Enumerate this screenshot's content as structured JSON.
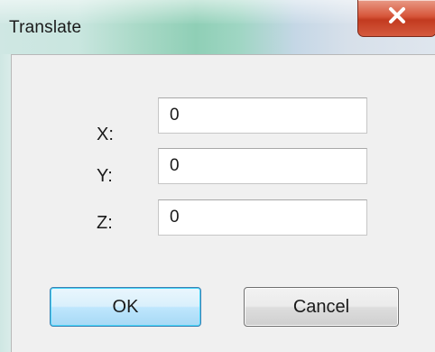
{
  "window": {
    "title": "Translate",
    "close_icon": "close-x-icon"
  },
  "fields": [
    {
      "label": "X:",
      "value": "0"
    },
    {
      "label": "Y:",
      "value": "0"
    },
    {
      "label": "Z:",
      "value": "0"
    }
  ],
  "buttons": {
    "ok_label": "OK",
    "cancel_label": "Cancel"
  },
  "colors": {
    "close_button": "#d45a3e",
    "ok_border": "#3c7fb1",
    "client_background": "#f0f0f0"
  }
}
